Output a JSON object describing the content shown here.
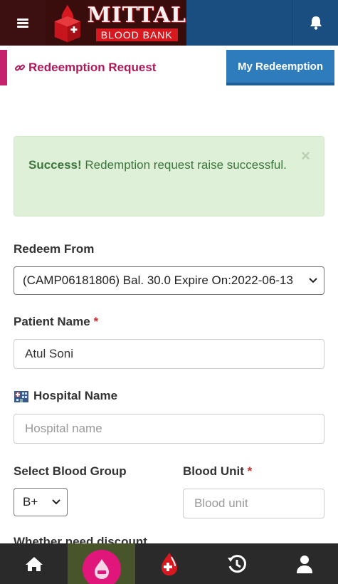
{
  "header": {
    "logo_title": "MITTAL",
    "logo_subtitle": "BLOOD BANK"
  },
  "tabs": {
    "active_label": "Redeemption Request",
    "other_label": "My Redeemption"
  },
  "alert": {
    "strong": "Success!",
    "message": " Redemption request raise successful.",
    "close": "×"
  },
  "form": {
    "redeem_from": {
      "label": "Redeem From",
      "selected": "(CAMP06181806) Bal. 30.0 Expire On:2022-06-13"
    },
    "patient_name": {
      "label": "Patient Name",
      "required_mark": "*",
      "value": "Atul Soni"
    },
    "hospital_name": {
      "label": "Hospital Name",
      "placeholder": "Hospital name"
    },
    "blood_group": {
      "label": "Select Blood Group",
      "selected": "B+"
    },
    "blood_unit": {
      "label": "Blood Unit",
      "required_mark": "*",
      "placeholder": "Blood unit"
    },
    "partial_label": "Whether need discount"
  },
  "bottom_nav": {
    "items": [
      "home-icon",
      "donate-icon",
      "blood-drop-icon",
      "history-icon",
      "profile-icon"
    ],
    "active": "donate-icon"
  },
  "colors": {
    "header_blue": "#1b4e80",
    "accent_magenta": "#b0195a",
    "tab_blue": "#2f7cbc",
    "success_bg": "#dff0d8",
    "success_text": "#3c763d",
    "nav_dark": "#2a2a2a"
  }
}
